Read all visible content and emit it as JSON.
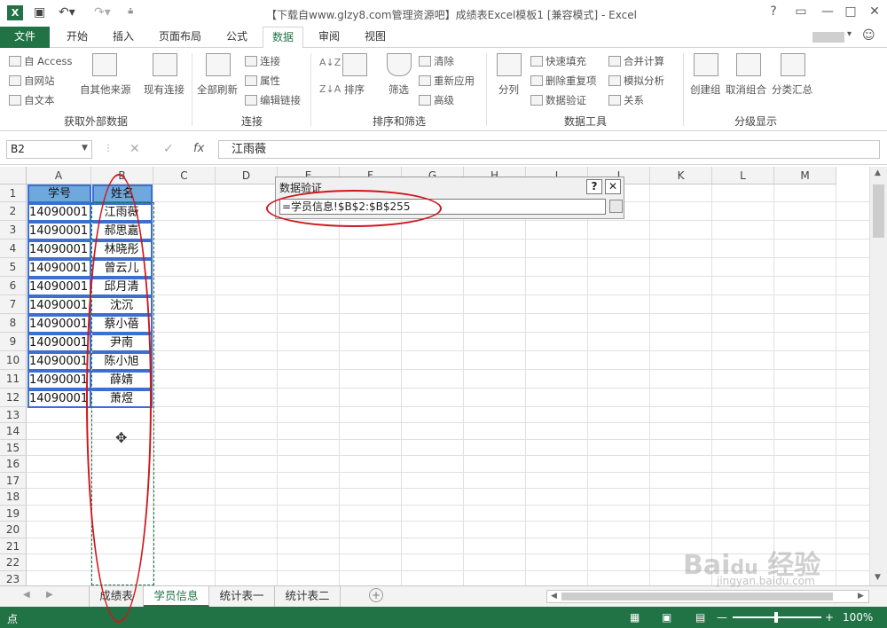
{
  "titlebar": {
    "title": "【下载自www.glzy8.com管理资源吧】成绩表Excel模板1  [兼容模式] - Excel",
    "help": "?",
    "minimize": "—",
    "restore": "□",
    "close": "✕"
  },
  "tabs": [
    "文件",
    "开始",
    "插入",
    "页面布局",
    "公式",
    "数据",
    "审阅",
    "视图"
  ],
  "active_tab": "数据",
  "ribbon": {
    "get_external": {
      "label": "获取外部数据",
      "items": [
        "自 Access",
        "自网站",
        "自文本"
      ],
      "other": "自其他来源"
    },
    "existing": "现有连接",
    "refresh_all": "全部刷新",
    "connections": {
      "label": "连接",
      "items": [
        "连接",
        "属性",
        "编辑链接"
      ]
    },
    "sort_filter": {
      "label": "排序和筛选",
      "sort": "排序",
      "filter": "筛选",
      "items": [
        "清除",
        "重新应用",
        "高级"
      ]
    },
    "data_tools": {
      "label": "数据工具",
      "split": "分列",
      "items": [
        "快速填充",
        "删除重复项",
        "数据验证",
        "合并计算",
        "模拟分析",
        "关系"
      ]
    },
    "outline": {
      "label": "分级显示",
      "items": [
        "创建组",
        "取消组合",
        "分类汇总"
      ]
    }
  },
  "formula_bar": {
    "namebox": "B2",
    "fx": "fx",
    "cancel": "✕",
    "enter": "✓",
    "value": "江雨薇"
  },
  "columns": [
    "A",
    "B",
    "C",
    "D",
    "E",
    "F",
    "G",
    "H",
    "I",
    "J",
    "K",
    "L",
    "M"
  ],
  "rows": [
    "1",
    "2",
    "3",
    "4",
    "5",
    "6",
    "7",
    "8",
    "9",
    "10",
    "11",
    "12",
    "13",
    "14",
    "15",
    "16",
    "17",
    "18",
    "19",
    "20",
    "21",
    "22",
    "23"
  ],
  "header_row": {
    "a": "学号",
    "b": "姓名"
  },
  "data_rows": [
    {
      "a": "14090001",
      "b": "江雨薇"
    },
    {
      "a": "14090001",
      "b": "郝思嘉"
    },
    {
      "a": "14090001",
      "b": "林晓彤"
    },
    {
      "a": "14090001",
      "b": "曾云儿"
    },
    {
      "a": "14090001",
      "b": "邱月清"
    },
    {
      "a": "14090001",
      "b": "沈沉"
    },
    {
      "a": "14090001",
      "b": "蔡小蓓"
    },
    {
      "a": "14090001",
      "b": "尹南"
    },
    {
      "a": "14090001",
      "b": "陈小旭"
    },
    {
      "a": "14090001",
      "b": "薛婧"
    },
    {
      "a": "14090001",
      "b": "萧煜"
    }
  ],
  "dialog": {
    "title": "数据验证",
    "help": "?",
    "close": "✕",
    "input": "=学员信息!$B$2:$B$255"
  },
  "sheets": [
    "成绩表",
    "学员信息",
    "统计表一",
    "统计表二"
  ],
  "active_sheet": "学员信息",
  "add_sheet": "+",
  "status": {
    "mode": "点",
    "zoom": "100%"
  },
  "watermark": "Bai du 经验 jingyan.baidu.com",
  "colors": {
    "excel_green": "#217346",
    "header_fill": "#6fa8dc",
    "annotation_red": "#d0161c"
  }
}
